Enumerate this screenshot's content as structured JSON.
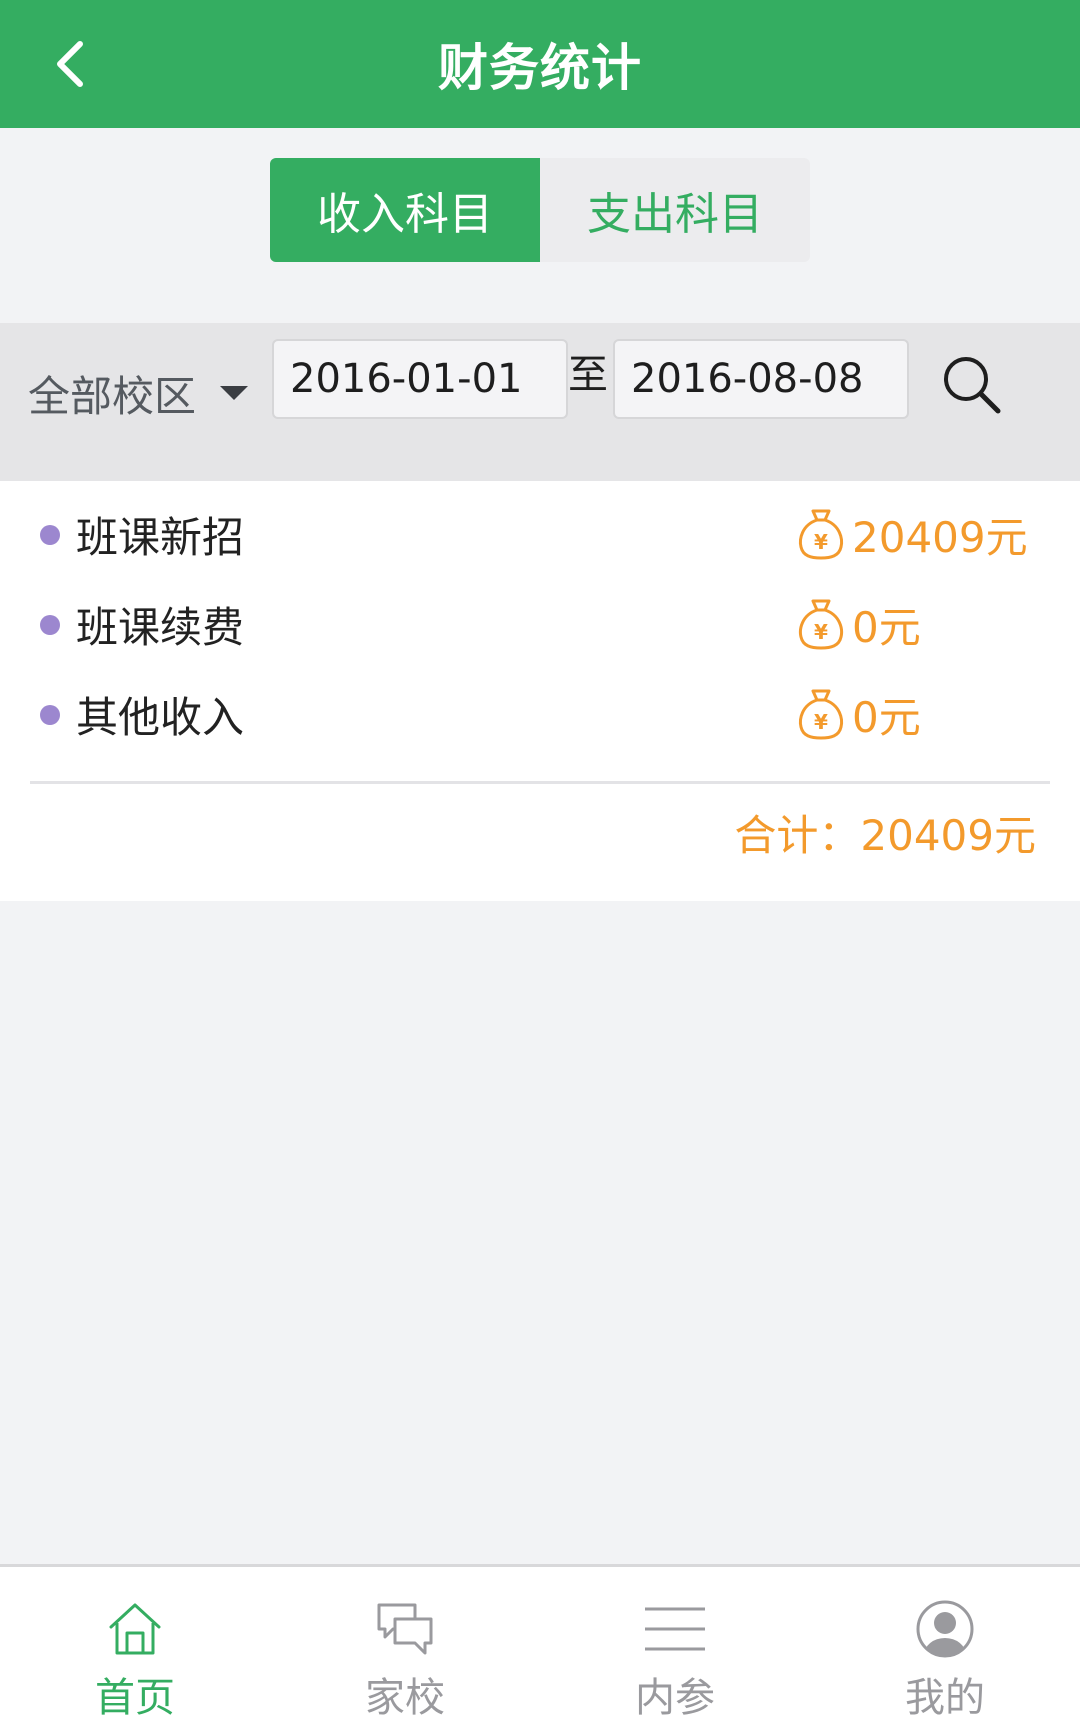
{
  "header": {
    "title": "财务统计",
    "back_icon": "chevron-left-icon"
  },
  "tabs": [
    {
      "label": "收入科目",
      "active": true
    },
    {
      "label": "支出科目",
      "active": false
    }
  ],
  "filter": {
    "campus": "全部校区",
    "start_date": "2016-01-01",
    "to_label": "至",
    "end_date": "2016-08-08",
    "search_icon": "search-icon"
  },
  "items": [
    {
      "name": "班课新招",
      "amount": "20409元"
    },
    {
      "name": "班课续费",
      "amount": "0元"
    },
    {
      "name": "其他收入",
      "amount": "0元"
    }
  ],
  "total": "合计：20409元",
  "bottom_nav": [
    {
      "label": "首页",
      "icon": "home-icon",
      "active": true
    },
    {
      "label": "家校",
      "icon": "chat-icon",
      "active": false
    },
    {
      "label": "内参",
      "icon": "menu-lines-icon",
      "active": false
    },
    {
      "label": "我的",
      "icon": "user-icon",
      "active": false
    }
  ],
  "colors": {
    "brand_green": "#34ad61",
    "amount_orange": "#f39a2c",
    "bullet_purple": "#9c87cf"
  }
}
